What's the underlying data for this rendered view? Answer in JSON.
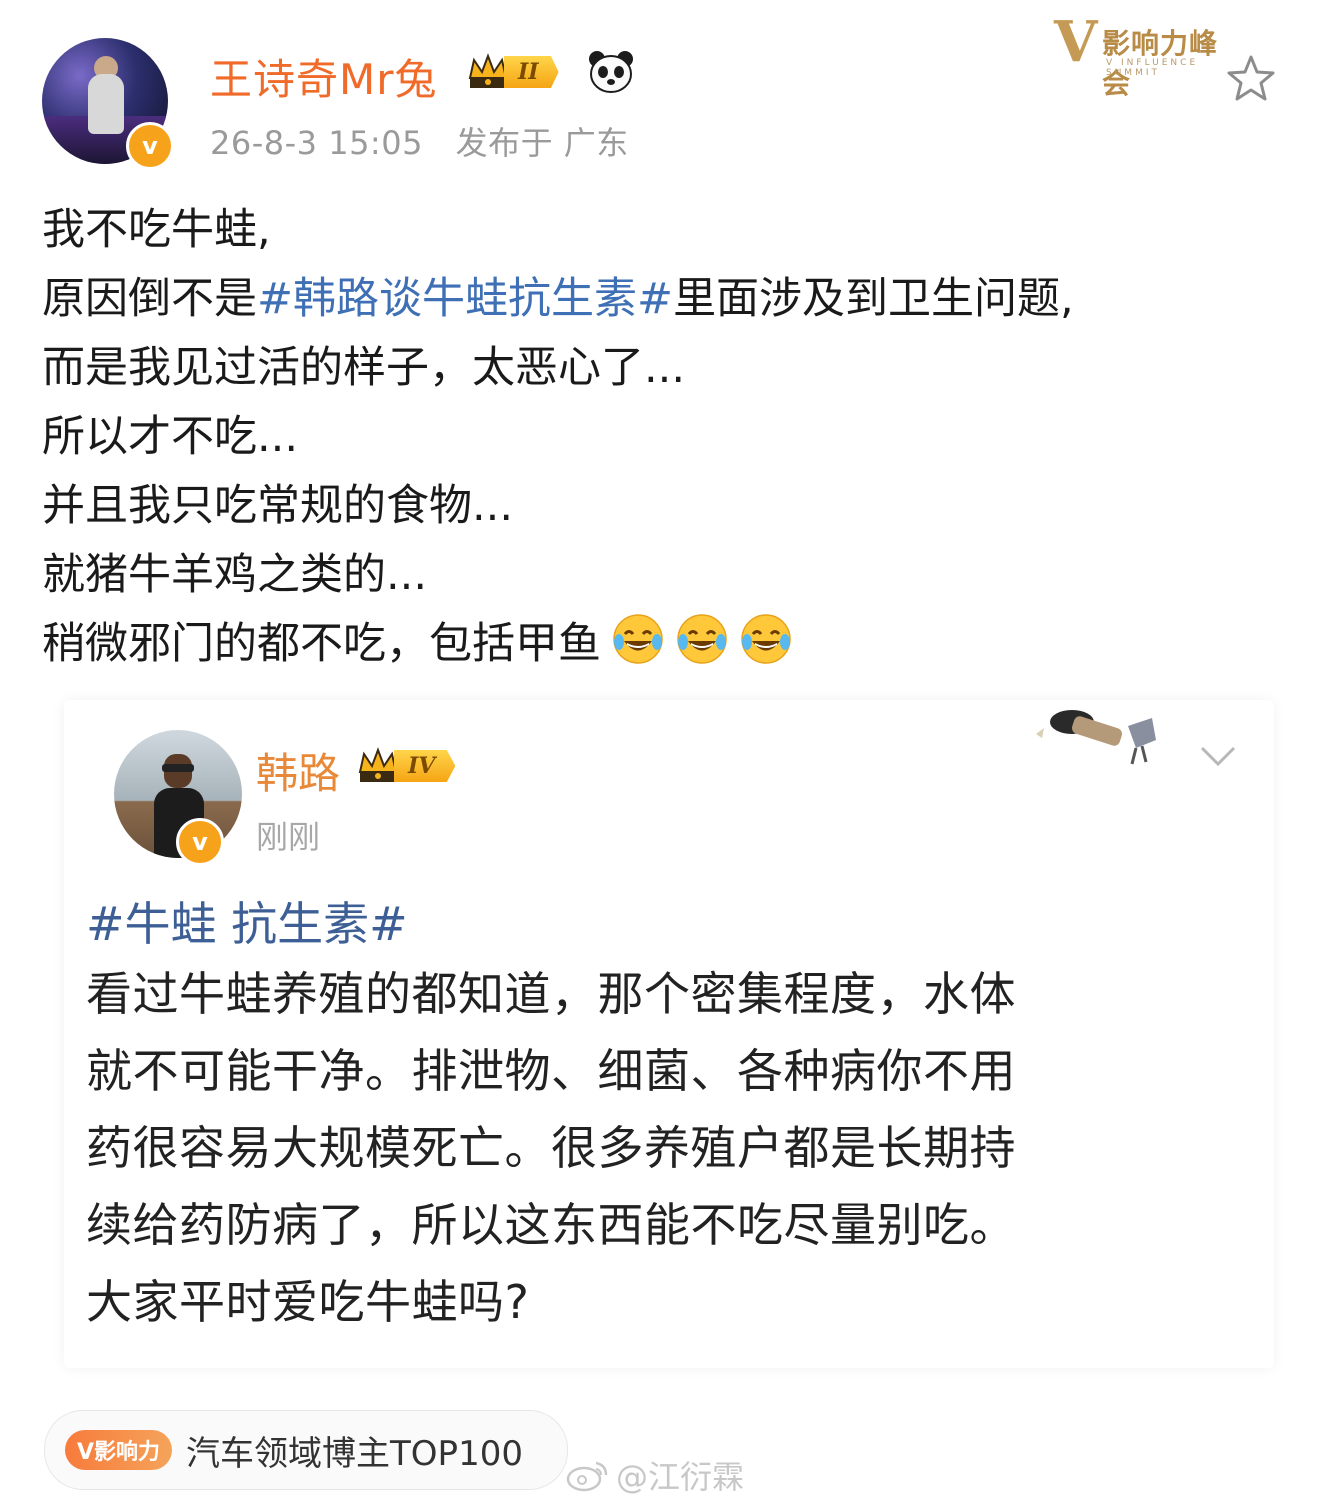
{
  "post": {
    "author": "王诗奇Mr兔",
    "level": "II",
    "time": "26-8-3 15:05",
    "location": "发布于 广东",
    "lines": [
      {
        "text": "我不吃牛蛙,"
      },
      {
        "before": "原因倒不是",
        "hashtag": "#韩路谈牛蛙抗生素#",
        "after": "里面涉及到卫生问题,"
      },
      {
        "text": "而是我见过活的样子，太恶心了..."
      },
      {
        "text": "所以才不吃..."
      },
      {
        "text": "并且我只吃常规的食物..."
      },
      {
        "text": "就猪牛羊鸡之类的..."
      },
      {
        "text": "稍微邪门的都不吃，包括甲鱼"
      }
    ],
    "emoji": [
      "laugh-cry-emoji",
      "laugh-cry-emoji",
      "laugh-cry-emoji"
    ]
  },
  "brand": {
    "logo_mark": "V",
    "logo_title": "影响力峰会",
    "logo_sub": "V INFLUENCE SUMMIT"
  },
  "quote": {
    "author": "韩路",
    "level": "IV",
    "time": "刚刚",
    "hashtag": "#牛蛙 抗生素#",
    "lines": [
      "看过牛蛙养殖的都知道，那个密集程度，水体",
      "就不可能干净。排泄物、细菌、各种病你不用",
      "药很容易大规模死亡。很多养殖户都是长期持",
      "续给药防病了，所以这东西能不吃尽量别吃。",
      "大家平时爱吃牛蛙吗?"
    ]
  },
  "footer": {
    "tag": "V影响力",
    "label": "汽车领域博主TOP100",
    "watermark": "@江衍霖"
  },
  "colors": {
    "username": "#f06a2a",
    "hashtag": "#3f6fb4",
    "meta": "#9a9a9a",
    "verified": "#f7a21b"
  }
}
